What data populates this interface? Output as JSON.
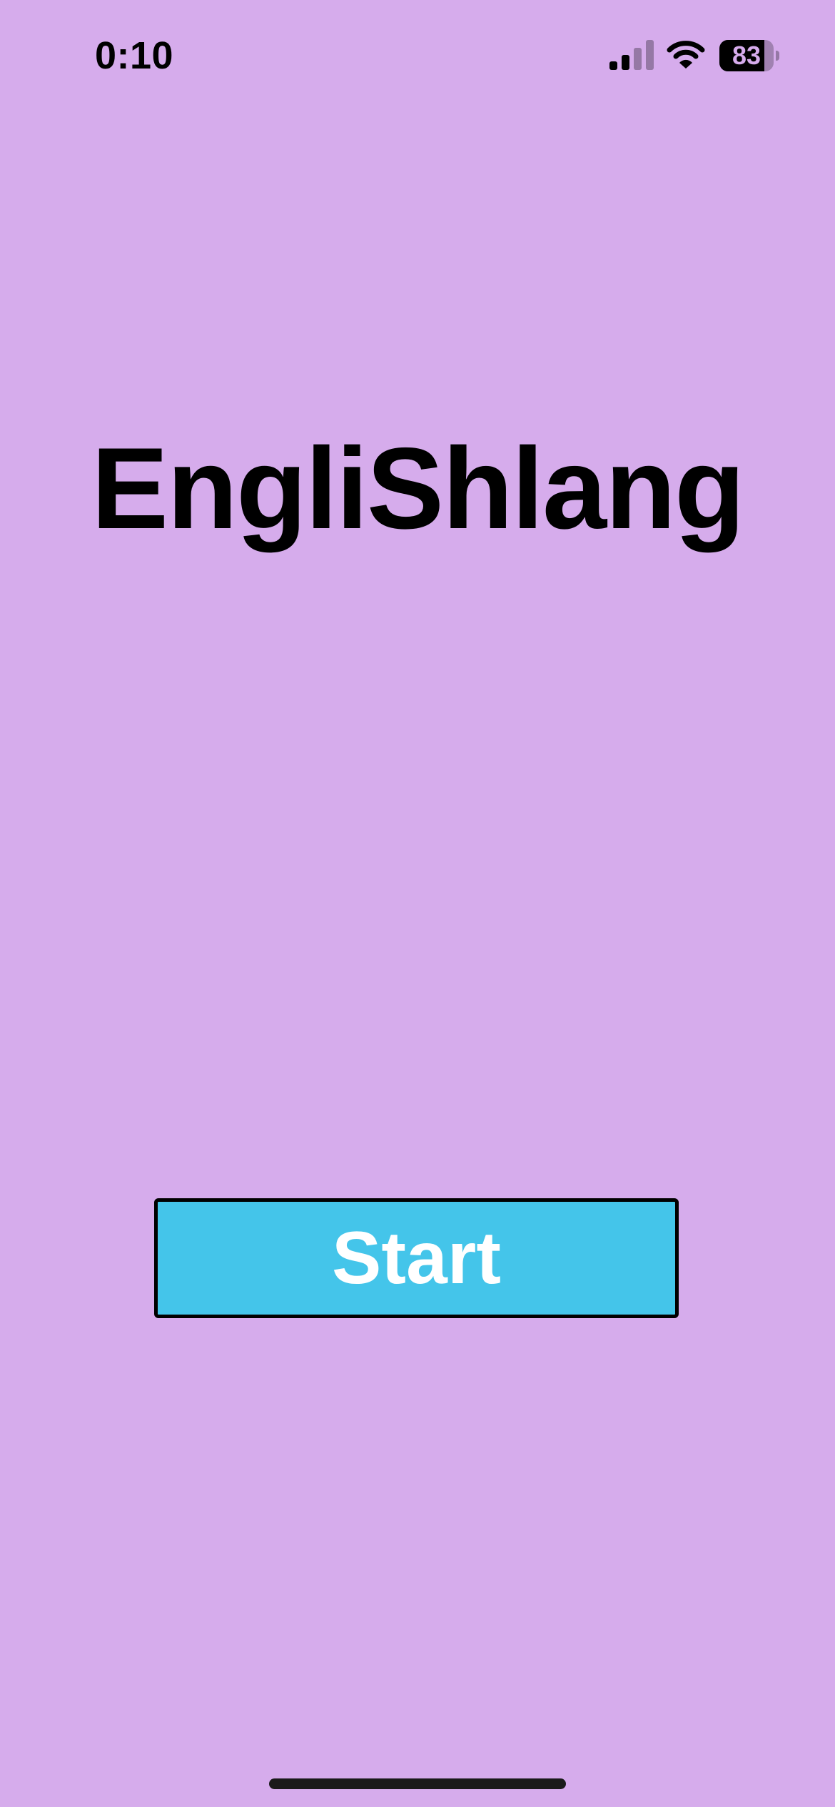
{
  "colors": {
    "background": "#d6acec",
    "button_fill": "#44c5ea",
    "button_border": "#000000",
    "button_text": "#ffffff",
    "title_text": "#000000"
  },
  "status_bar": {
    "time": "0:10",
    "battery_percent": "83",
    "battery_level": 0.83,
    "signal_bars_active": 2,
    "signal_bars_total": 4,
    "icons": [
      "signal-icon",
      "wifi-icon",
      "battery-icon"
    ]
  },
  "main": {
    "title": "EngliShlang",
    "start_button_label": "Start"
  }
}
